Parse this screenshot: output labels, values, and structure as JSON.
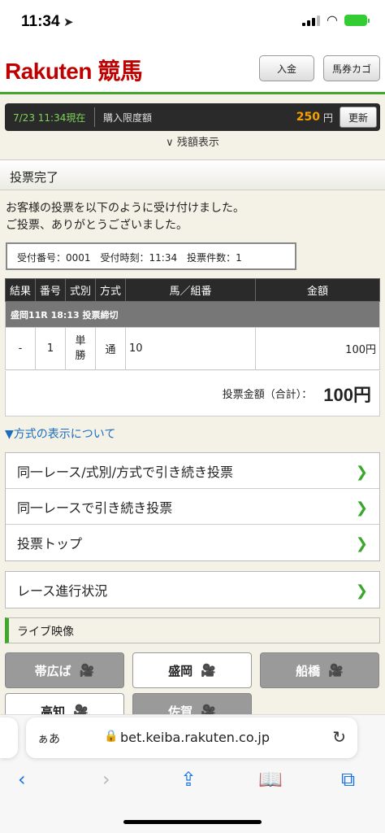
{
  "status": {
    "time": "11:34"
  },
  "header": {
    "logo": "Rakuten 競馬",
    "deposit_label": "入金",
    "cart_label": "馬券カゴ"
  },
  "limit": {
    "datetime": "7/23 11:34現在",
    "label": "購入限度額",
    "amount": "250",
    "unit": "円",
    "update_label": "更新",
    "balance_toggle": "残額表示"
  },
  "page": {
    "title": "投票完了",
    "message_line1": "お客様の投票を以下のように受け付けました。",
    "message_line2": "ご投票、ありがとうございました。",
    "receipt": "受付番号：0001　受付時刻：11:34　投票件数：1"
  },
  "bets": {
    "columns": [
      "結果",
      "番号",
      "式別",
      "方式",
      "馬／組番",
      "金額"
    ],
    "race_header": "盛岡11R 18:13 投票締切",
    "row": {
      "result": "-",
      "number": "1",
      "type": "単勝",
      "method": "通",
      "horses": "10",
      "amount": "100円"
    },
    "total_label": "投票金額（合計）：",
    "total_value": "100円"
  },
  "method_link": "▼方式の表示について",
  "nav": {
    "same_race_type": "同一レース/式別/方式で引き続き投票",
    "same_race": "同一レースで引き続き投票",
    "vote_top": "投票トップ",
    "race_progress": "レース進行状況"
  },
  "live": {
    "title": "ライブ映像",
    "venues": [
      "帯広ば",
      "盛岡",
      "船橋",
      "高知",
      "佐賀"
    ]
  },
  "browser": {
    "aa": "ぁあ",
    "url": "bet.keiba.rakuten.co.jp"
  }
}
